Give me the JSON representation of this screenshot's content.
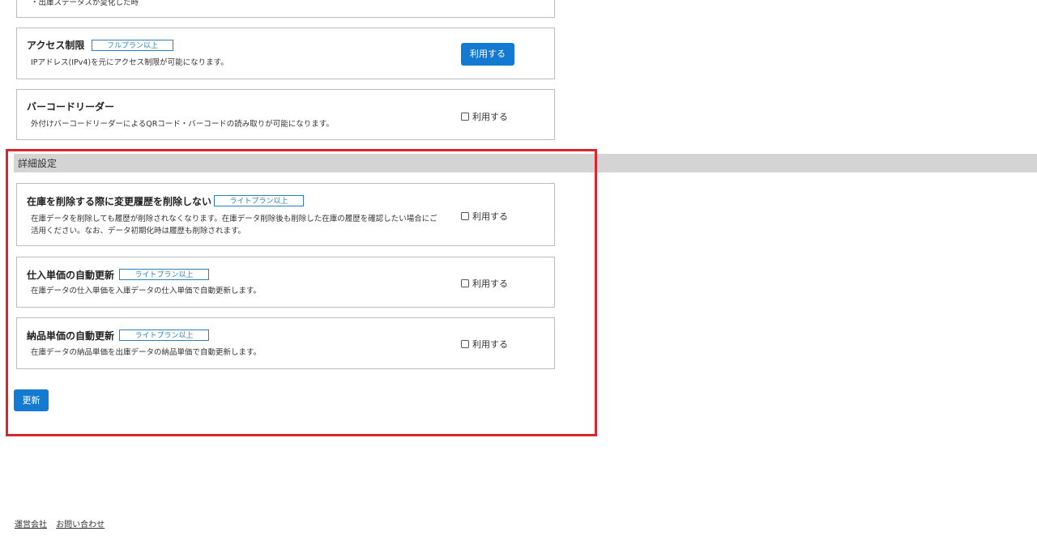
{
  "top_card": {
    "desc_tail": "・出庫ステータスが変化した時"
  },
  "access_control": {
    "title": "アクセス制限",
    "badge": "フルプラン以上",
    "desc": "IPアドレス(IPv4)を元にアクセス制限が可能になります。",
    "button_label": "利用する"
  },
  "barcode_reader": {
    "title": "バーコードリーダー",
    "desc": "外付けバーコードリーダーによるQRコード・バーコードの読み取りが可能になります。",
    "check_label": "利用する",
    "checked": false
  },
  "advanced_section": {
    "title": "詳細設定",
    "items": [
      {
        "title": "在庫を削除する際に変更履歴を削除しない",
        "badge": "ライトプラン以上",
        "desc": "在庫データを削除しても履歴が削除されなくなります。在庫データ削除後も削除した在庫の履歴を確認したい場合にご活用ください。なお、データ初期化時は履歴も削除されます。",
        "check_label": "利用する",
        "checked": false
      },
      {
        "title": "仕入単価の自動更新",
        "badge": "ライトプラン以上",
        "desc": "在庫データの仕入単価を入庫データの仕入単価で自動更新します。",
        "check_label": "利用する",
        "checked": false
      },
      {
        "title": "納品単価の自動更新",
        "badge": "ライトプラン以上",
        "desc": "在庫データの納品単価を出庫データの納品単価で自動更新します。",
        "check_label": "利用する",
        "checked": false
      }
    ],
    "update_button": "更新"
  },
  "footer": {
    "links": [
      "運営会社",
      "お問い合わせ"
    ]
  },
  "colors": {
    "primary": "#1479d0",
    "badge": "#2a7fc4",
    "highlight": "#d9262e",
    "section_bar": "#d4d4d4"
  }
}
